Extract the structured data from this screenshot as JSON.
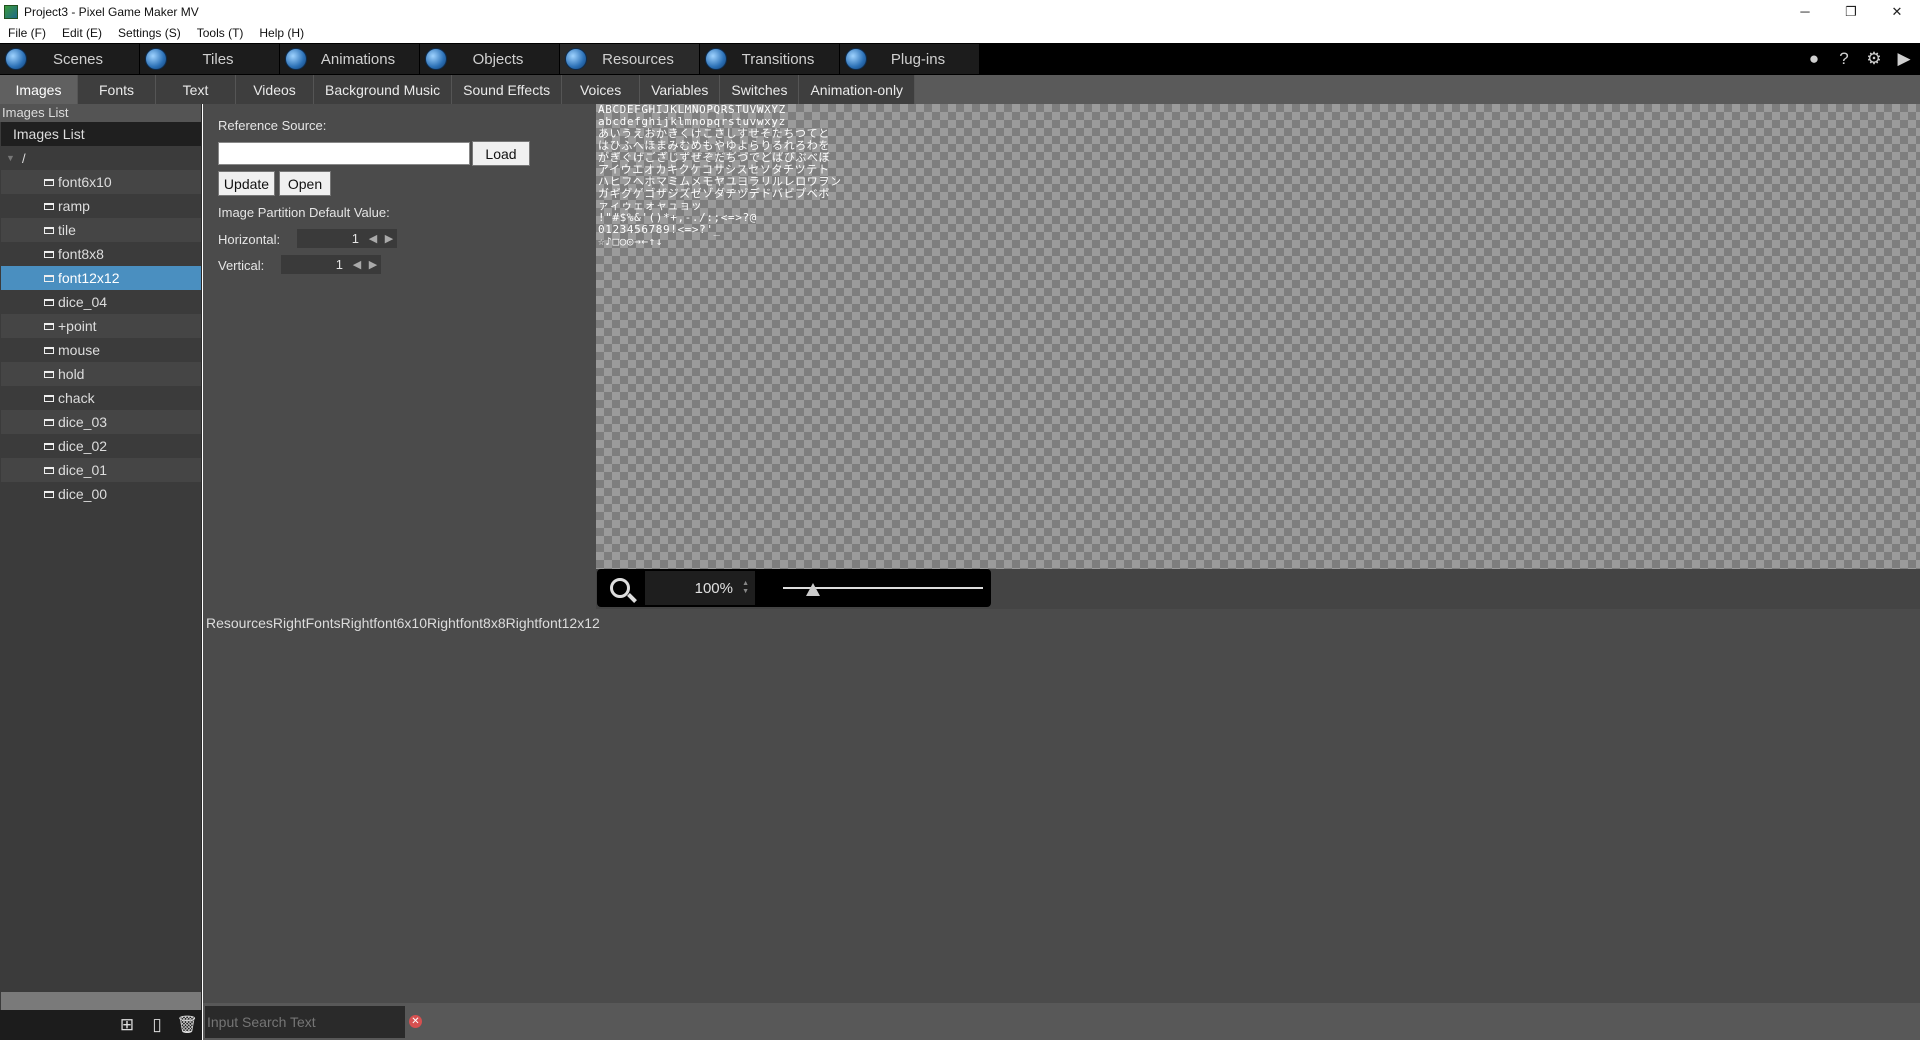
{
  "window": {
    "title": "Project3 - Pixel Game Maker MV",
    "minimize": "─",
    "restore": "❐",
    "close": "✕"
  },
  "menu": [
    "File (F)",
    "Edit (E)",
    "Settings (S)",
    "Tools (T)",
    "Help (H)"
  ],
  "category_tabs": [
    {
      "label": "Scenes",
      "icon": "scenes-icon"
    },
    {
      "label": "Tiles",
      "icon": "tiles-icon"
    },
    {
      "label": "Animations",
      "icon": "animations-icon"
    },
    {
      "label": "Objects",
      "icon": "objects-icon"
    },
    {
      "label": "Resources",
      "icon": "resources-icon",
      "active": true
    },
    {
      "label": "Transitions",
      "icon": "transitions-icon"
    },
    {
      "label": "Plug-ins",
      "icon": "plugins-icon"
    }
  ],
  "top_right_icons": {
    "record": "●",
    "help": "?",
    "settings": "⚙",
    "play": "▶"
  },
  "resource_tabs": [
    "Images",
    "Fonts",
    "Text",
    "Videos",
    "Background Music",
    "Sound Effects",
    "Voices",
    "Variables",
    "Switches",
    "Animation-only"
  ],
  "left_panel": {
    "title": "Images List",
    "header": "Images List",
    "root": "/",
    "items": [
      "font6x10",
      "ramp",
      "tile",
      "font8x8",
      "font12x12",
      "dice_04",
      "+point",
      "mouse",
      "hold",
      "chack",
      "dice_03",
      "dice_02",
      "dice_01",
      "dice_00"
    ],
    "selected_index": 4
  },
  "properties": {
    "reference_source_label": "Reference Source:",
    "reference_source_value": "",
    "load_button": "Load",
    "update_button": "Update",
    "open_button": "Open",
    "partition_label": "Image Partition Default Value:",
    "horizontal_label": "Horizontal:",
    "horizontal_value": "1",
    "vertical_label": "Vertical:",
    "vertical_value": "1"
  },
  "preview": {
    "font_sheet_lines": [
      "ABCDEFGHIJKLMNOPQRSTUVWXYZ",
      "abcdefghijklmnopqrstuvwxyz",
      "あいうえおかきくけこさしすせそたちつてと",
      "はひふへほまみむめもやゆよらりるれろわを",
      "がぎぐげござじずぜぞだぢづでどばびぶべぼ",
      "アイウエオカキクケコサシスセソタチツテト",
      "ハヒフヘホマミムメモヤユヨラリルレロワヲン",
      "ガギグゲゴザジズゼゾダヂヅデドバビブベボ",
      "ァィゥェォャュョッ",
      "!\"#$%&'()*+,-./:;<=>?@",
      "0123456789!<=>?'_",
      "☆♪□○◎→←↑↓"
    ]
  },
  "zoom": {
    "value": "100%",
    "slider_fraction": 0.15
  },
  "path_text": "ResourcesRightFontsRightfont6x10Rightfont8x8Rightfont12x12",
  "search": {
    "placeholder": "Input Search Text",
    "clear": "✕"
  },
  "bottom_buttons": {
    "add_folder": "⊞",
    "add_file": "▯",
    "delete": "🗑"
  }
}
